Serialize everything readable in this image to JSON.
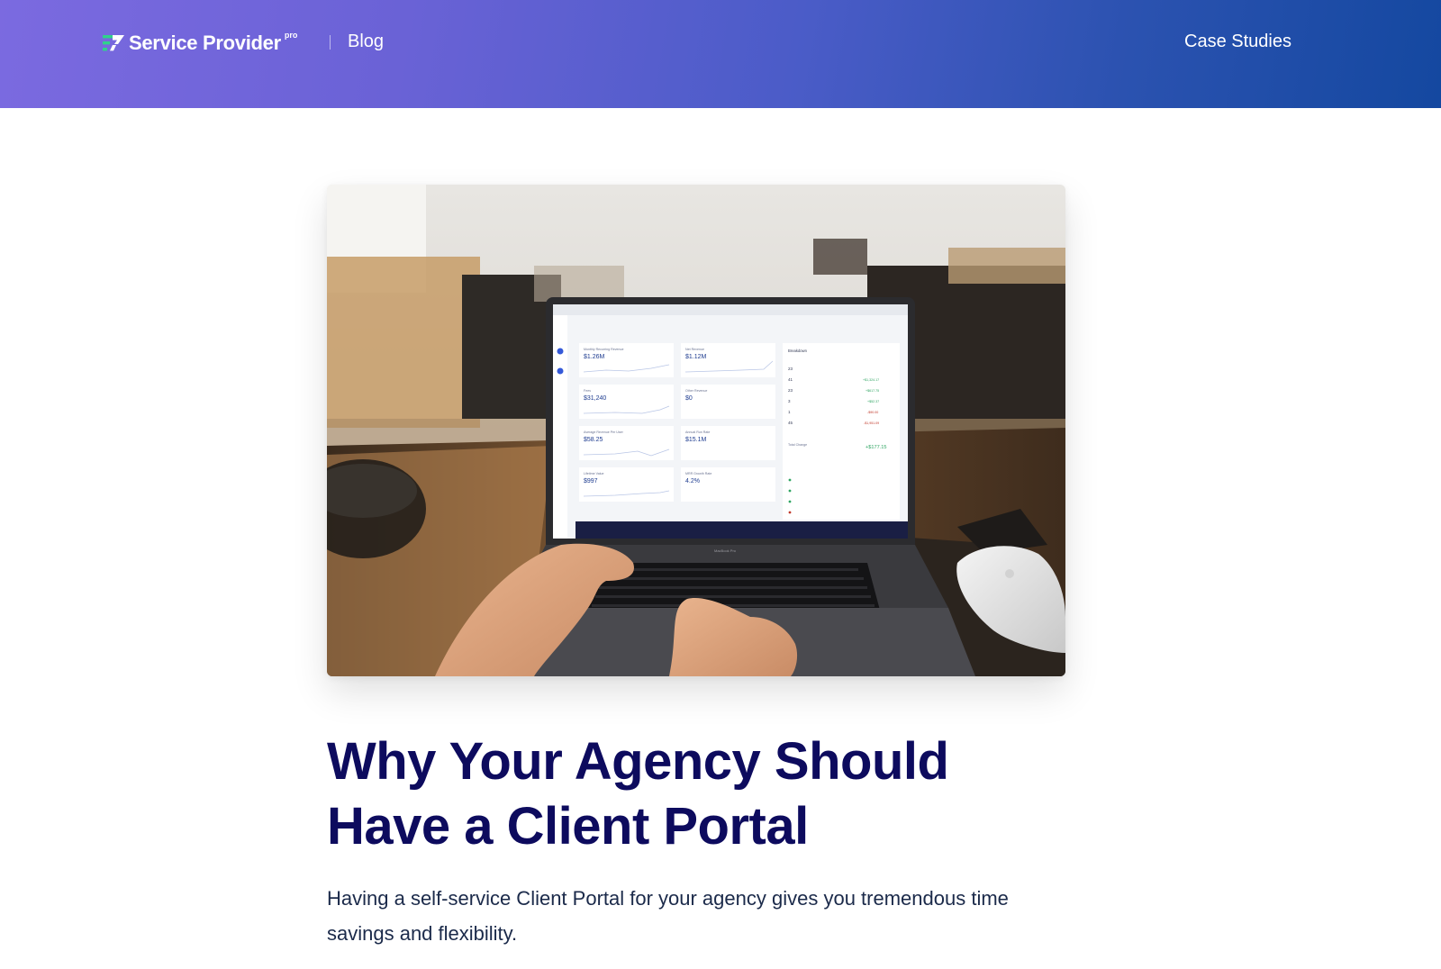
{
  "header": {
    "brand": "Service Provider",
    "brand_sup": "pro",
    "blog_link": "Blog",
    "case_studies_link": "Case Studies",
    "gradient_start": "#7b6ae0",
    "gradient_end": "#1448a0"
  },
  "hero": {
    "image_subject": "laptop-dashboard-photo",
    "dashboard": {
      "metrics": [
        {
          "label": "Monthly Recurring Revenue",
          "value": "$1.26M"
        },
        {
          "label": "Net Revenue",
          "value": "$1.12M"
        },
        {
          "label": "Fees",
          "value": "$31,240"
        },
        {
          "label": "Other Revenue",
          "value": "$0"
        },
        {
          "label": "Average Revenue Per User",
          "value": "$58.25"
        },
        {
          "label": "Annual Run Rate",
          "value": "$15.1M"
        },
        {
          "label": "Lifetime Value",
          "value": "$997"
        },
        {
          "label": "MRR Growth Rate",
          "value": "4.2%"
        }
      ],
      "breakdown_title": "Breakdown",
      "breakdown_rows": [
        {
          "count": "23",
          "amount": ""
        },
        {
          "count": "41",
          "amount": "+$1,324.17"
        },
        {
          "count": "23",
          "amount": "+$617.75"
        },
        {
          "count": "3",
          "amount": "+$52.37"
        },
        {
          "count": "1",
          "amount": "-$90.00"
        },
        {
          "count": "45",
          "amount": "-$1,951.09"
        }
      ],
      "total_label": "Total Change",
      "total_value": "+$177.15",
      "laptop_label": "MacBook Pro"
    }
  },
  "article": {
    "title": "Why Your Agency Should Have a Client Portal",
    "intro": "Having a self-service Client Portal for your agency gives you tremendous time savings and flexibility."
  }
}
